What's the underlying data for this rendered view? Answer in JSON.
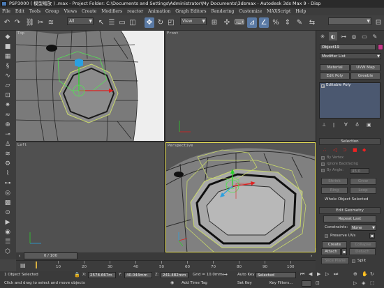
{
  "app": {
    "title": "PSP3000 ( 模型缩放 ) .max - Project Folder: C:\\Documents and Settings\\Administrator\\My Documents\\3dsmax - Autodesk 3ds Max 9 - Disp"
  },
  "menu": {
    "items": [
      "File",
      "Edit",
      "Tools",
      "Group",
      "Views",
      "Create",
      "Modifiers",
      "reactor",
      "Animation",
      "Graph Editors",
      "Rendering",
      "Customize",
      "MAXScript",
      "Help"
    ]
  },
  "toolbar": {
    "selection_filter": "All",
    "reference_coord": "View",
    "named_selection": ""
  },
  "viewports": {
    "top_label": "Top",
    "front_label": "Front",
    "left_label": "Left",
    "perspective_label": "Perspective"
  },
  "command_panel": {
    "object_name": "Object19",
    "object_color": "#c83a8c",
    "modifier_list_label": "Modifier List",
    "buttons": {
      "material": "Material",
      "uvw_map": "UVW Map",
      "edit_poly": "Edit Poly",
      "greeble": "Greeble"
    },
    "stack_item": "Editable Poly",
    "selection": {
      "title": "Selection",
      "by_vertex": "By Vertex",
      "ignore_backfacing": "Ignore Backfacing",
      "by_angle": "By Angle:",
      "by_angle_value": "45.0",
      "shrink": "Shrink",
      "grow": "Grow",
      "ring": "Ring",
      "loop": "Loop",
      "whole_object_selected": "Whole Object Selected"
    },
    "edit_geometry": {
      "title": "Edit Geometry",
      "repeat_last": "Repeat Last",
      "constraints_label": "Constraints:",
      "constraints_value": "None",
      "preserve_uvs": "Preserve UVs",
      "create": "Create",
      "collapse": "Collapse",
      "attach": "Attach",
      "detach": "Detach",
      "slice_plane": "Slice Plane",
      "split": "Split"
    }
  },
  "timeline": {
    "slider": "0 / 100",
    "ticks": [
      "10",
      "20",
      "30",
      "40",
      "50",
      "60",
      "70",
      "80",
      "90",
      "100"
    ]
  },
  "status": {
    "selection_info": "1 Object Selected",
    "prompt": "Click and drag to select and move objects",
    "x_label": "X:",
    "x_value": "2578.667m",
    "y_label": "Y:",
    "y_value": "40.044mm",
    "z_label": "Z:",
    "z_value": "241.482mm",
    "grid": "Grid = 10.0mm",
    "add_time_tag": "Add Time Tag",
    "auto_key": "Auto Key",
    "set_key": "Set Key",
    "key_mode": "Selected",
    "key_filters": "Key Filters..."
  }
}
